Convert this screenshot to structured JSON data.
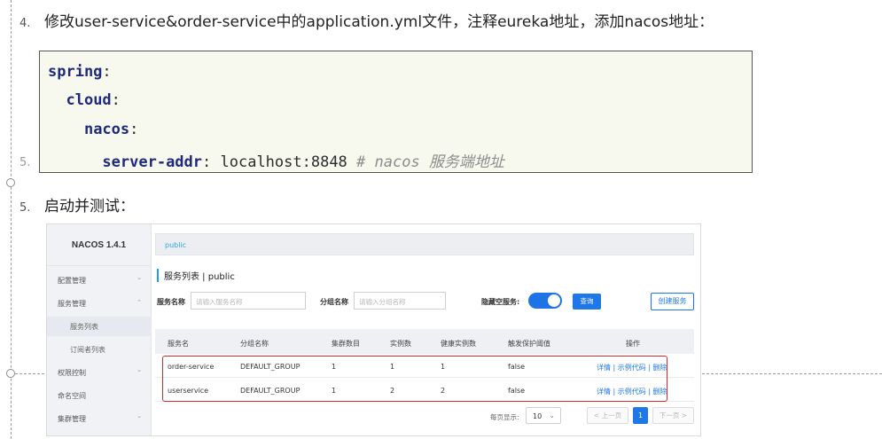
{
  "steps": {
    "step4_num": "4.",
    "step4_text": "修改user-service&order-service中的application.yml文件，注释eureka地址，添加nacos地址：",
    "ghost_num": "5.",
    "step5_num": "5.",
    "step5_text": "启动并测试："
  },
  "code": {
    "l1_key": "spring",
    "l1_sep": ":",
    "l2_key": "cloud",
    "l2_sep": ":",
    "l3_key": "nacos",
    "l3_sep": ":",
    "l4_key": "server-addr",
    "l4_sep": ": ",
    "l4_value": "localhost:8848",
    "l4_comment": "# nacos 服务端地址"
  },
  "nacos": {
    "brand": "NACOS 1.4.1",
    "sidebar": [
      {
        "label": "配置管理",
        "chevron": "⌄"
      },
      {
        "label": "服务管理",
        "chevron": "⌃"
      },
      {
        "label": "服务列表"
      },
      {
        "label": "订阅者列表"
      },
      {
        "label": "权限控制",
        "chevron": "⌄"
      },
      {
        "label": "命名空间"
      },
      {
        "label": "集群管理",
        "chevron": "⌄"
      }
    ],
    "namespace": "public",
    "page_title": "服务列表  |  public",
    "filters": {
      "service_label": "服务名称",
      "service_placeholder": "请输入服务名称",
      "group_label": "分组名称",
      "group_placeholder": "请输入分组名称",
      "hide_empty_label": "隐藏空服务:",
      "hide_empty_on": true,
      "query_button": "查询",
      "create_button": "创建服务"
    },
    "table": {
      "headers": [
        "服务名",
        "分组名称",
        "集群数目",
        "实例数",
        "健康实例数",
        "触发保护阈值",
        "操作"
      ],
      "rows": [
        [
          "order-service",
          "DEFAULT_GROUP",
          "1",
          "1",
          "1",
          "false"
        ],
        [
          "userservice",
          "DEFAULT_GROUP",
          "1",
          "2",
          "2",
          "false"
        ]
      ],
      "ops": "详情 | 示例代码 | 删除"
    },
    "pager": {
      "page_size_label": "每页显示:",
      "page_size": "10",
      "prev": "< 上一页",
      "current": "1",
      "next": "下一页 >"
    },
    "colors": {
      "accent": "#1f78e8",
      "highlight": "#d62a2a",
      "code_bg": "#f8f9ee"
    }
  }
}
